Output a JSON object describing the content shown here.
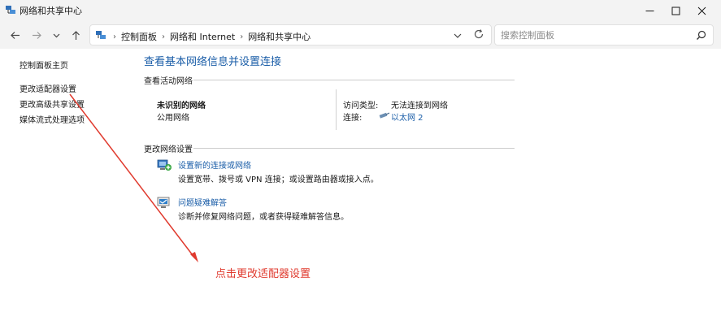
{
  "window": {
    "title": "网络和共享中心",
    "minimize_icon": "minimize-icon",
    "maximize_icon": "maximize-icon",
    "close_icon": "close-icon"
  },
  "nav": {
    "back_icon": "arrow-left-icon",
    "forward_icon": "arrow-right-icon",
    "recent_icon": "chevron-down-icon",
    "up_icon": "arrow-up-icon"
  },
  "address": {
    "crumbs": [
      "控制面板",
      "网络和 Internet",
      "网络和共享中心"
    ],
    "dropdown_icon": "chevron-down-icon",
    "refresh_icon": "refresh-icon"
  },
  "search": {
    "placeholder": "搜索控制面板",
    "icon": "search-icon"
  },
  "sidebar": {
    "items": [
      {
        "label": "控制面板主页"
      },
      {
        "label": "更改适配器设置"
      },
      {
        "label": "更改高级共享设置"
      },
      {
        "label": "媒体流式处理选项"
      }
    ]
  },
  "main": {
    "title": "查看基本网络信息并设置连接",
    "active_section": "查看活动网络",
    "network": {
      "name": "未识别的网络",
      "type": "公用网络",
      "access_label": "访问类型:",
      "access_value": "无法连接到网络",
      "connection_label": "连接:",
      "connection_value": "以太网 2"
    },
    "change_section": "更改网络设置",
    "tasks": [
      {
        "link": "设置新的连接或网络",
        "desc": "设置宽带、拨号或 VPN 连接；或设置路由器或接入点。"
      },
      {
        "link": "问题疑难解答",
        "desc": "诊断并修复网络问题，或者获得疑难解答信息。"
      }
    ]
  },
  "annotation": {
    "text": "点击更改适配器设置",
    "color": "#e03a2e"
  },
  "colors": {
    "link": "#1b5ea8",
    "chrome": "#f3f3f3",
    "annotation": "#e03a2e"
  }
}
